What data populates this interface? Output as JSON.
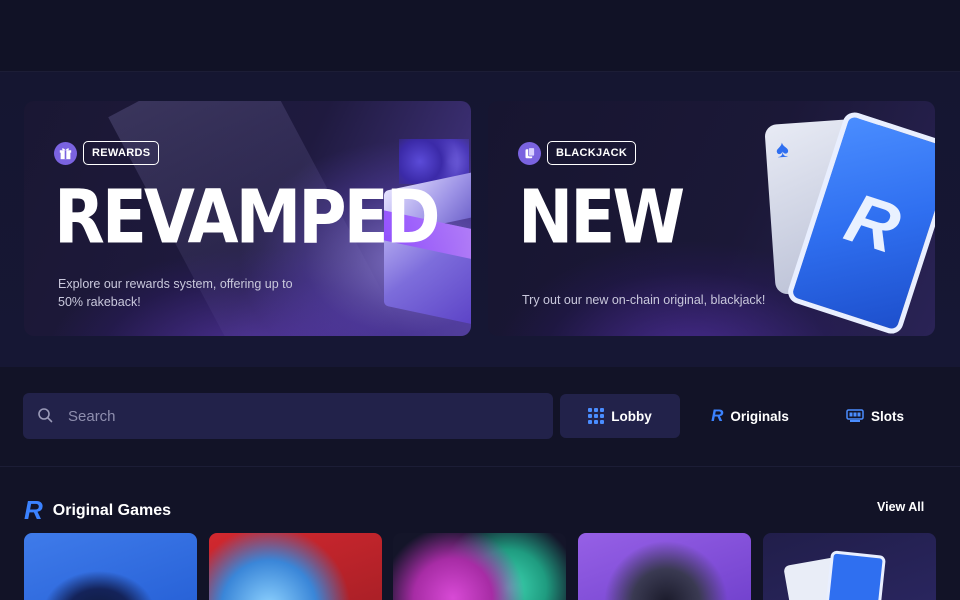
{
  "banners": [
    {
      "tag": "REWARDS",
      "tag_icon": "gift-icon",
      "headline": "REVAMPED",
      "description": "Explore our rewards system, offering up to 50% rakeback!"
    },
    {
      "tag": "BLACKJACK",
      "tag_icon": "cards-icon",
      "headline": "NEW",
      "description": "Try out our new on-chain original, blackjack!"
    }
  ],
  "search": {
    "placeholder": "Search",
    "value": ""
  },
  "tabs": [
    {
      "label": "Lobby",
      "icon": "grid-icon",
      "active": true
    },
    {
      "label": "Originals",
      "icon": "r-logo-icon",
      "active": false
    },
    {
      "label": "Slots",
      "icon": "slot-machine-icon",
      "active": false
    }
  ],
  "section": {
    "title": "Original Games",
    "view_all": "View All"
  },
  "colors": {
    "background": "#121327",
    "accent": "#3b82ff",
    "tag_icon": "#7a63e0"
  }
}
